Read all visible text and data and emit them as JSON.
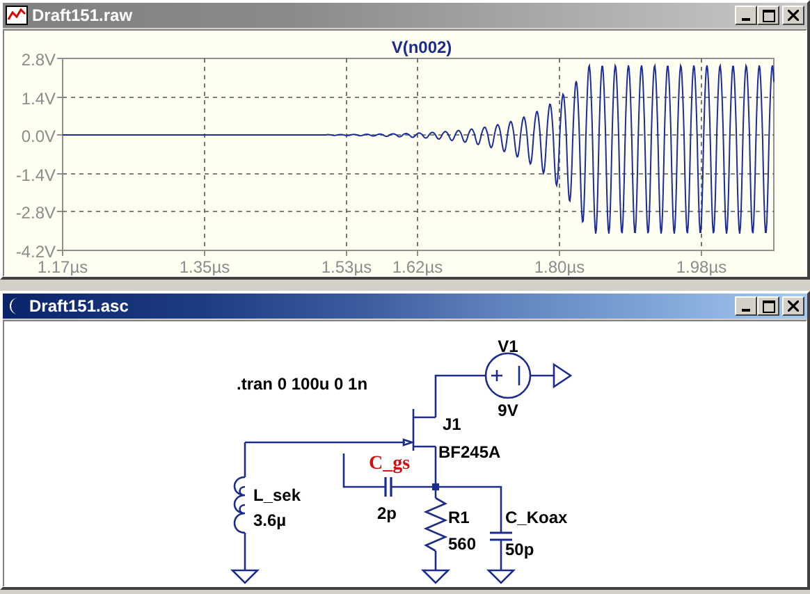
{
  "plot_window": {
    "title": "Draft151.raw",
    "active": false,
    "trace_label": "V(n002)",
    "y_axis_labels": [
      "2.8V",
      "1.4V",
      "0.0V",
      "-1.4V",
      "-2.8V",
      "-4.2V"
    ],
    "x_axis_labels": [
      "1.17µs",
      "1.35µs",
      "1.53µs",
      "1.62µs",
      "1.80µs",
      "1.98µs"
    ]
  },
  "schematic_window": {
    "title": "Draft151.asc",
    "active": true,
    "directive": ".tran 0 100u 0 1n",
    "components": [
      {
        "name": "V1",
        "value": "9V",
        "highlighted": false
      },
      {
        "name": "J1",
        "value": "BF245A",
        "highlighted": false
      },
      {
        "name": "L_sek",
        "value": "3.6µ",
        "highlighted": false
      },
      {
        "name": "C_gs",
        "value": "2p",
        "highlighted": true
      },
      {
        "name": "R1",
        "value": "560",
        "highlighted": false
      },
      {
        "name": "C_Koax",
        "value": "50p",
        "highlighted": false
      }
    ]
  }
}
